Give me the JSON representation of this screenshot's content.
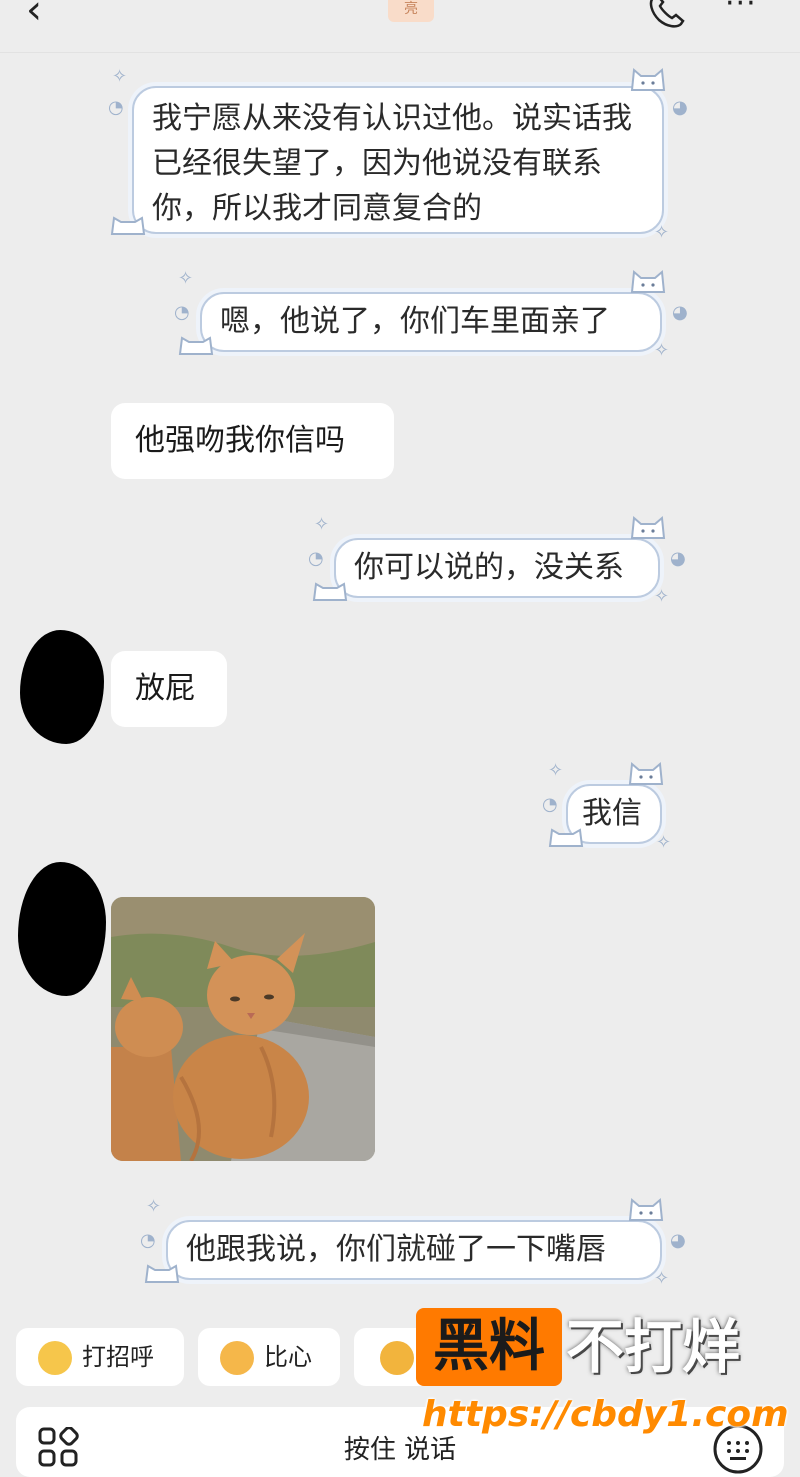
{
  "header": {
    "back_icon": "chevron-left-icon",
    "title_fragment": "亮",
    "phone_icon": "phone-icon",
    "more_icon": "more-icon",
    "more_glyph": "···"
  },
  "messages": [
    {
      "side": "right",
      "style": "fancy",
      "text": "我宁愿从来没有认识过他。说实话我已经很失望了，因为他说没有联系你，所以我才同意复合的"
    },
    {
      "side": "right",
      "style": "fancy",
      "text": "嗯，他说了，你们车里面亲了"
    },
    {
      "side": "left",
      "style": "plain",
      "text": "他强吻我你信吗"
    },
    {
      "side": "right",
      "style": "fancy",
      "text": "你可以说的，没关系"
    },
    {
      "side": "left",
      "style": "plain",
      "text": "放屁"
    },
    {
      "side": "right",
      "style": "fancy",
      "text": "我信"
    },
    {
      "side": "left",
      "style": "image",
      "image_desc": "two orange cats"
    },
    {
      "side": "right",
      "style": "fancy",
      "text": "他跟我说，你们就碰了一下嘴唇"
    }
  ],
  "quick_replies": [
    {
      "label": "打招呼",
      "icon": "smile-emoji-icon"
    },
    {
      "label": "比心",
      "icon": "heart-hands-emoji-icon"
    },
    {
      "label": "",
      "icon": "thumbs-up-emoji-icon"
    }
  ],
  "input": {
    "label": "按住 说话",
    "apps_icon": "apps-icon",
    "keyboard_icon": "keyboard-icon"
  },
  "watermark": {
    "brand_box": "黑料",
    "brand_text": "不打烊",
    "url": "https://cbdy1.com"
  },
  "colors": {
    "background": "#ededed",
    "bubble": "#ffffff",
    "fancy_border": "#bccbe0",
    "watermark_orange": "#ff7a00"
  }
}
